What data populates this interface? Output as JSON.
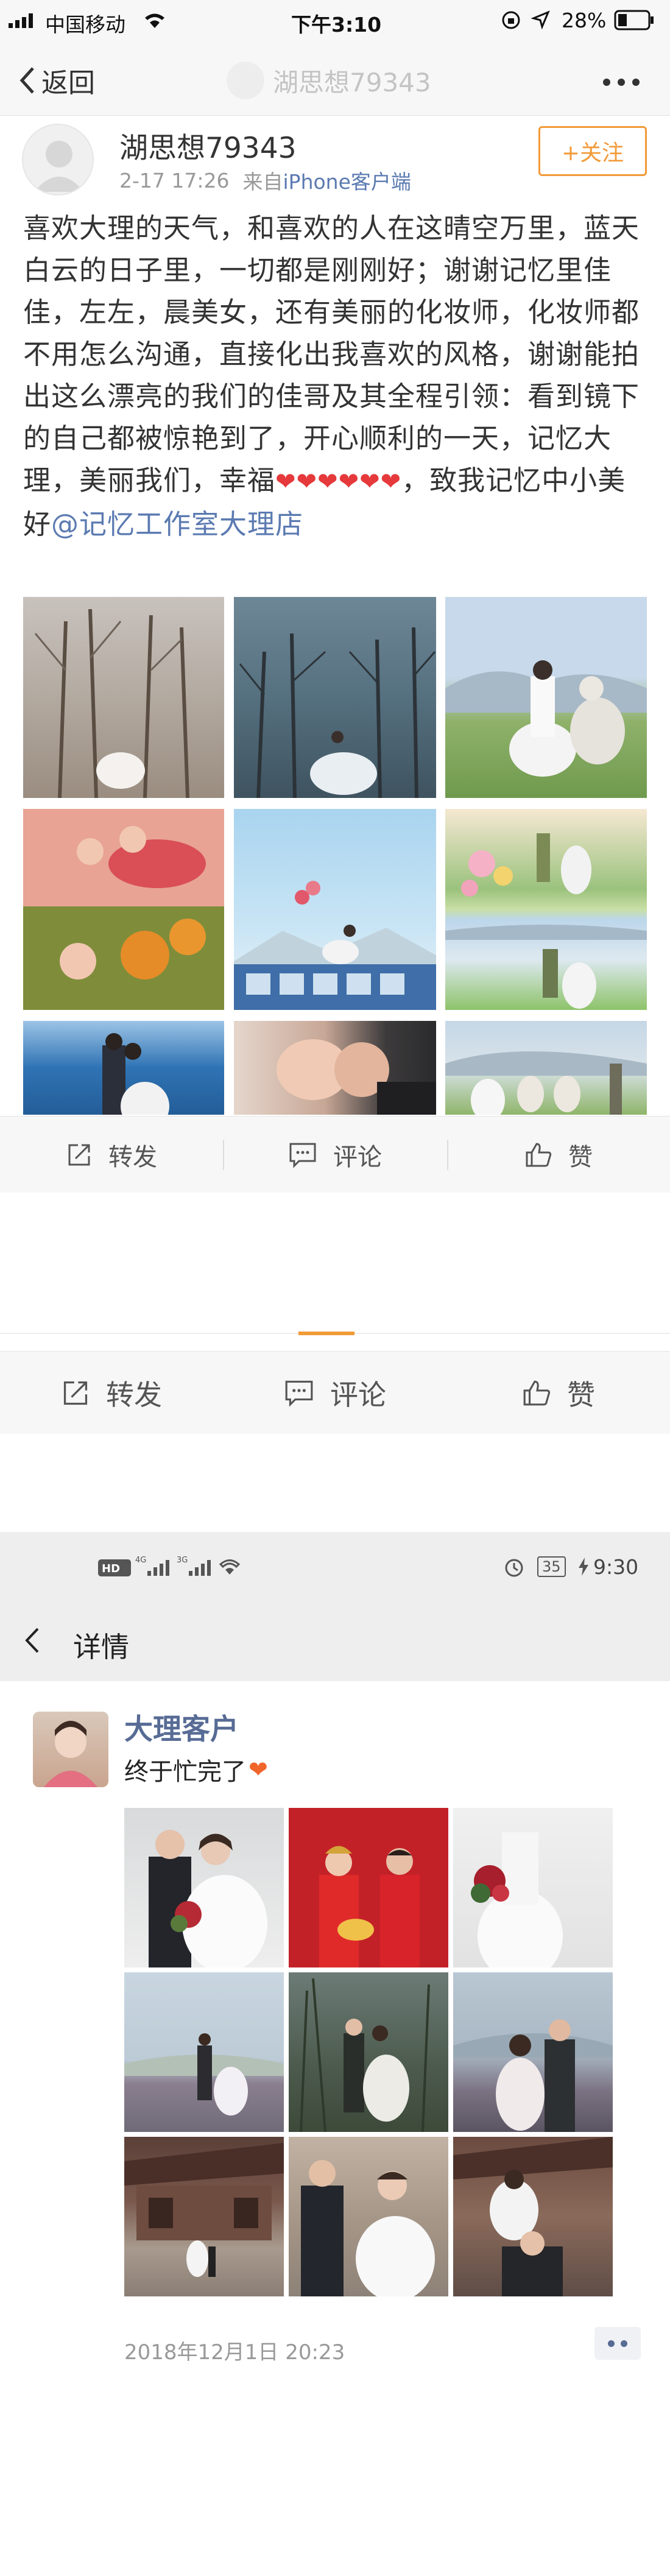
{
  "status1": {
    "carrier": "中国移动",
    "time": "下午3:10",
    "battery": "28%"
  },
  "nav1": {
    "back_label": "返回",
    "title": "湖思想79343"
  },
  "post": {
    "author": "湖思想79343",
    "time": "2-17 17:26",
    "source_prefix": "来自",
    "source": "iPhone客户端",
    "follow_label": "+关注",
    "text_part1": "喜欢大理的天气，和喜欢的人在这晴空万里，蓝天白云的日子里，一切都是刚刚好；谢谢记忆里佳佳，左左，晨美女，还有美丽的化妆师，化妆师都不用怎么沟通，直接化出我喜欢的风格，谢谢能拍出这么漂亮的我们的佳哥及其全程引领：看到镜下的自己都被惊艳到了，开心顺利的一天，记忆大理，美丽我们，幸福",
    "hearts": "❤❤❤❤❤❤",
    "text_part2": "，致我记忆中小美好",
    "mention": "@记忆工作室大理店",
    "repost_label": "转发",
    "comment_label": "评论",
    "like_label": "赞"
  },
  "actions2": {
    "repost_label": "转发",
    "comment_label": "评论",
    "like_label": "赞"
  },
  "status2": {
    "battery": "35",
    "time": "9:30"
  },
  "nav2": {
    "title": "详情"
  },
  "moment": {
    "author": "大理客户",
    "text": "终于忙完了",
    "emoji": "❤",
    "timestamp": "2018年12月1日 20:23"
  },
  "colors": {
    "accent_orange": "#f29a38",
    "link_blue": "#5b7ab1",
    "moment_name": "#576b95",
    "heart_red": "#e5393b"
  }
}
